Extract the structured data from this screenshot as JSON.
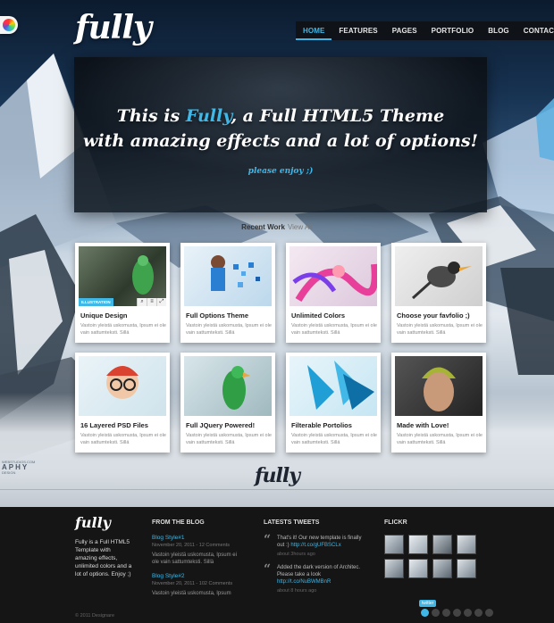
{
  "brand": {
    "logo": "fully"
  },
  "nav": [
    "HOME",
    "FEATURES",
    "PAGES",
    "PORTFOLIO",
    "BLOG",
    "CONTACT"
  ],
  "hero": {
    "line1_pre": "This is ",
    "line1_accent": "Fully",
    "line1_post": ", a Full HTML5 Theme",
    "line2": "with amazing effects and a lot of options!",
    "cta": "please enjoy ;)"
  },
  "recent": {
    "title": "Recent Work",
    "view_all": "View All"
  },
  "portfolio": [
    {
      "title": "Unique Design",
      "desc": "Vastoin yleistä uskomusta, Ipsum ei ole vain sattumteksti. Sillä",
      "badge": "ILLUSTRATION"
    },
    {
      "title": "Full Options Theme",
      "desc": "Vastoin yleistä uskomusta, Ipsum ei ole vain sattumteksti. Sillä"
    },
    {
      "title": "Unlimited Colors",
      "desc": "Vastoin yleistä uskomusta, Ipsum ei ole vain sattumteksti. Sillä"
    },
    {
      "title": "Choose your favfolio ;)",
      "desc": "Vastoin yleistä uskomusta, Ipsum ei ole vain sattumteksti. Sillä"
    },
    {
      "title": "16 Layered PSD Files",
      "desc": "Vastoin yleistä uskomusta, Ipsum ei ole vain sattumteksti. Sillä"
    },
    {
      "title": "Full JQuery Powered!",
      "desc": "Vastoin yleistä uskomusta, Ipsum ei ole vain sattumteksti. Sillä"
    },
    {
      "title": "Filterable Portolios",
      "desc": "Vastoin yleistä uskomusta, Ipsum ei ole vain sattumteksti. Sillä"
    },
    {
      "title": "Made with Love!",
      "desc": "Vastoin yleistä uskomusta, Ipsum ei ole vain sattumteksti. Sillä"
    }
  ],
  "divider_logo": "fully",
  "side_text": {
    "small": "WEBSTUDIOS.COM",
    "big": "APHY",
    "tiny": "DESIGN"
  },
  "footer": {
    "logo": "fully",
    "about": "Fully is a Full HTML5 Template with amazing effects, unlimited colors and a lot of options. Enjoy ;)",
    "blog_head": "FROM THE BLOG",
    "posts": [
      {
        "title": "Blog Style#1",
        "meta": "November 20, 2011 - 12 Comments",
        "text": "Vastoin yleistä uskomusta, Ipsum ei ole vain sattumteksti. Sillä"
      },
      {
        "title": "Blog Style#2",
        "meta": "November 20, 2011 - 102 Comments",
        "text": "Vastoin yleistä uskomusta, Ipsum"
      }
    ],
    "tweets_head": "LATESTS TWEETS",
    "tweets": [
      {
        "text": "That's it! Our new template is finally out :) ",
        "link": "http://t.co/gUFBSCLx",
        "time": "about 3hours ago"
      },
      {
        "text": "Added the dark version of Architec. Please take a look ",
        "link": "http://t.co/NuBWMBnR",
        "time": "about 8 hours ago"
      }
    ],
    "flickr_head": "FLICKR",
    "copyright": "© 2011 Designare",
    "twitter_tip": "twitter"
  },
  "colors": {
    "accent": "#3fb8e8",
    "footer_bg": "#151515"
  }
}
